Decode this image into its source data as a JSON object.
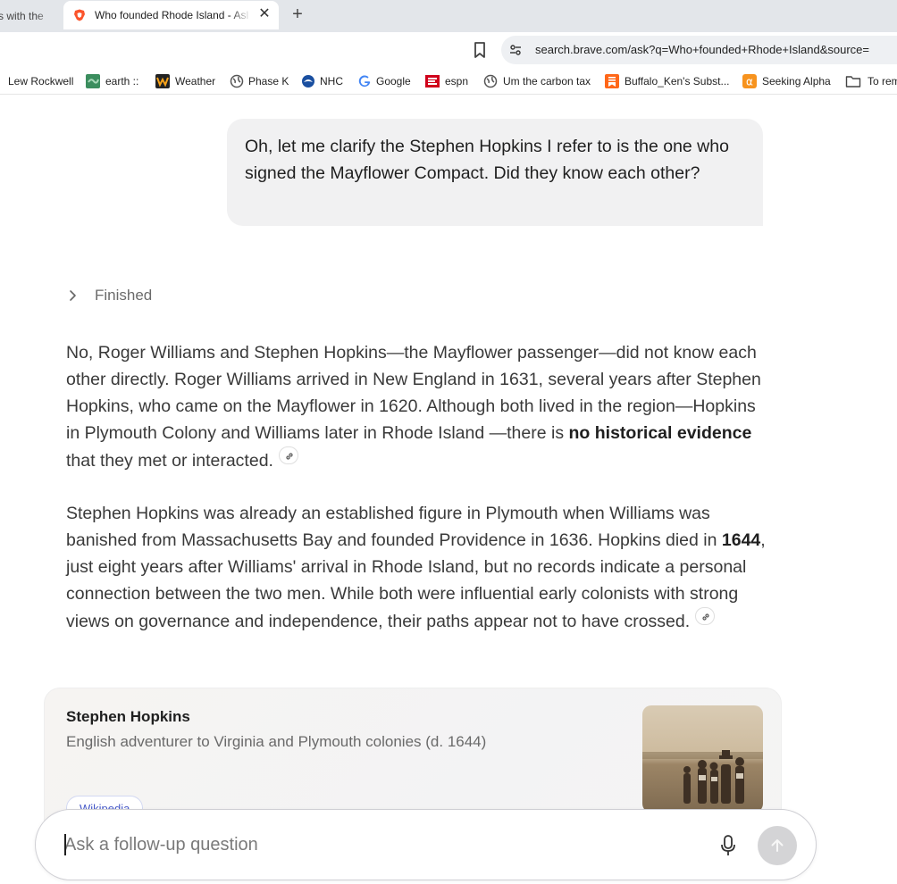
{
  "browser": {
    "inactive_tab_text": "s with the",
    "active_tab_title": "Who founded Rhode Island - Asl",
    "close_glyph": "✕",
    "new_tab_glyph": "+",
    "url": "search.brave.com/ask?q=Who+founded+Rhode+Island&source="
  },
  "bookmarks": [
    {
      "label": "Lew Rockwell",
      "icon": "none"
    },
    {
      "label": "earth ::",
      "icon": "earth-icon"
    },
    {
      "label": "Weather",
      "icon": "weather-icon"
    },
    {
      "label": "Phase K",
      "icon": "globe-icon"
    },
    {
      "label": "NHC",
      "icon": "noaa-icon"
    },
    {
      "label": "Google",
      "icon": "google-icon"
    },
    {
      "label": "espn",
      "icon": "espn-icon"
    },
    {
      "label": "Um the carbon tax",
      "icon": "globe-icon"
    },
    {
      "label": "Buffalo_Ken's Subst...",
      "icon": "substack-icon"
    },
    {
      "label": "Seeking Alpha",
      "icon": "seeking-alpha-icon"
    },
    {
      "label": "To rem",
      "icon": "folder-icon"
    }
  ],
  "chat": {
    "user_message": "Oh, let me clarify the Stephen Hopkins I refer to is the one who signed the Mayflower Compact.  Did they know each other?",
    "status": "Finished",
    "p1": {
      "a": "No, Roger Williams and Stephen Hopkins—the Mayflower passenger—did not know each other directly. Roger Williams arrived in New England in 1631, several years after Stephen Hopkins, who came on the Mayflower in 1620. Although both lived in the region—Hopkins in Plymouth Colony and Williams later in Rhode Island —there is ",
      "bold": "no historical evidence",
      "b": " that they met or interacted."
    },
    "p2": {
      "a": "Stephen Hopkins was already an established figure in Plymouth when Williams was banished from Massachusetts Bay and founded Providence in 1636. Hopkins died in ",
      "bold": "1644",
      "b": ", just eight years after Williams' arrival in Rhode Island, but no records indicate a personal connection between the two men. While both were influential early colonists with strong views on governance and independence, their paths appear not to have crossed."
    }
  },
  "card": {
    "title": "Stephen Hopkins",
    "subtitle": "English adventurer to Virginia and Plymouth colonies (d. 1644)",
    "badge": "Wikipedia"
  },
  "ask": {
    "placeholder": "Ask a follow-up question"
  },
  "colors": {
    "tabstrip": "#e3e6ea",
    "bubble": "#f1f1f2",
    "brave_orange": "#fb542b",
    "link_badge": "#4457c7"
  }
}
